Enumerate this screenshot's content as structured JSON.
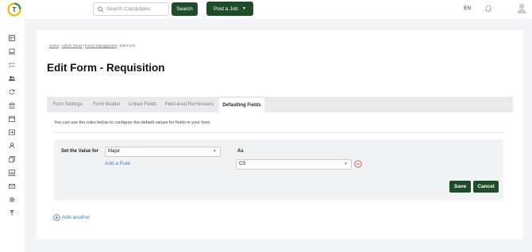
{
  "header": {
    "search_placeholder": "Search Candidates",
    "search_button": "Search",
    "post_job_button": "Post a Job",
    "language": "EN"
  },
  "sidebar": {
    "icons": [
      "dashboard-icon",
      "laptop-icon",
      "checklist-icon",
      "people-icon",
      "refresh-icon",
      "building-icon",
      "calendar-icon",
      "export-icon",
      "user-group-icon",
      "documents-icon",
      "chart-icon",
      "mail-icon",
      "settings-icon",
      "upload-icon"
    ]
  },
  "breadcrumb": {
    "home": "Home",
    "admin": "Admin Panel",
    "forms": "Forms Management",
    "current": "Edit Form",
    "separator": "/"
  },
  "page": {
    "title": "Edit Form - Requisition"
  },
  "tabs": [
    {
      "label": "Form Settings",
      "active": false
    },
    {
      "label": "Form Builder",
      "active": false
    },
    {
      "label": "Linked Fields",
      "active": false
    },
    {
      "label": "Field-level Permissions",
      "active": false
    },
    {
      "label": "Defaulting Fields",
      "active": true
    }
  ],
  "defaulting": {
    "description": "You can use the rules below to configure the default values for fields in your form.",
    "set_label": "Set the Value for",
    "field_value": "Major",
    "as_label": "As",
    "as_value": "CS",
    "add_rule": "Add a Rule",
    "save": "Save",
    "cancel": "Cancel",
    "add_another": "Add another"
  },
  "colors": {
    "brand_green": "#1f4d2c",
    "link_blue": "#4a7fb5",
    "remove_red": "#d9534f"
  }
}
